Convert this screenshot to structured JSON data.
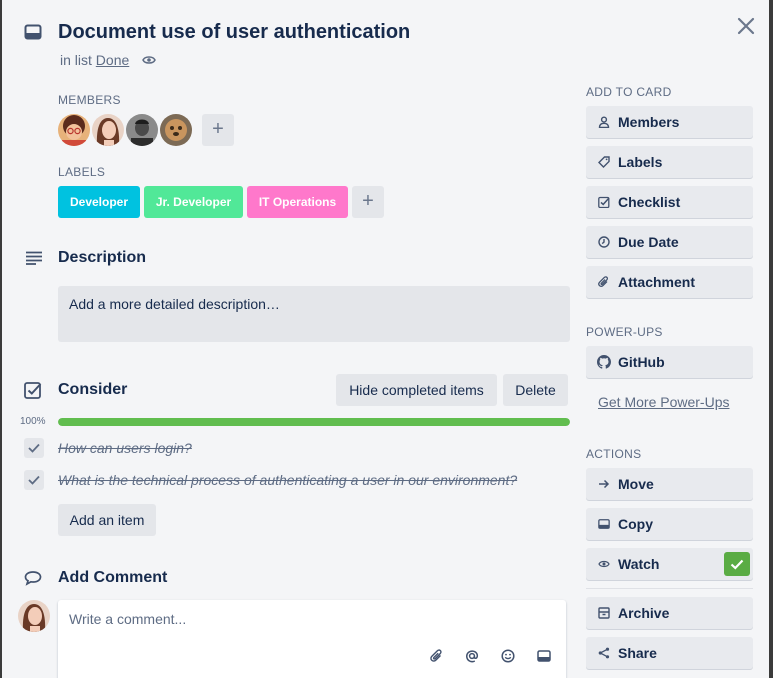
{
  "card": {
    "title": "Document use of user authentication",
    "in_list_prefix": "in list",
    "list_name": "Done"
  },
  "members": {
    "heading": "MEMBERS",
    "add_label": "+"
  },
  "labels": {
    "heading": "LABELS",
    "items": [
      {
        "text": "Developer",
        "color": "#00c2e0"
      },
      {
        "text": "Jr. Developer",
        "color": "#51e898"
      },
      {
        "text": "IT Operations",
        "color": "#ff78cb"
      }
    ],
    "add_label": "+"
  },
  "description": {
    "heading": "Description",
    "placeholder": "Add a more detailed description…"
  },
  "checklist": {
    "heading": "Consider",
    "hide_button": "Hide completed items",
    "delete_button": "Delete",
    "percent_text": "100%",
    "progress": 1.0,
    "progress_color": "#61bd4f",
    "items": [
      {
        "text": "How can users login?"
      },
      {
        "text": "What is the technical process of authenticating a user in our environment?"
      }
    ],
    "add_item_button": "Add an item"
  },
  "comment": {
    "heading": "Add Comment",
    "placeholder": "Write a comment..."
  },
  "sidebar": {
    "add_to_card_heading": "ADD TO CARD",
    "add_to_card": [
      {
        "label": "Members",
        "icon": "person-icon"
      },
      {
        "label": "Labels",
        "icon": "tag-icon"
      },
      {
        "label": "Checklist",
        "icon": "checklist-icon"
      },
      {
        "label": "Due Date",
        "icon": "clock-icon"
      },
      {
        "label": "Attachment",
        "icon": "paperclip-icon"
      }
    ],
    "powerups_heading": "POWER-UPS",
    "github_label": "GitHub",
    "get_more_powerups": "Get More Power-Ups",
    "actions_heading": "ACTIONS",
    "actions": [
      {
        "label": "Move",
        "icon": "arrow-right-icon"
      },
      {
        "label": "Copy",
        "icon": "card-icon"
      },
      {
        "label": "Watch",
        "icon": "eye-icon"
      },
      {
        "label": "Archive",
        "icon": "archive-icon"
      },
      {
        "label": "Share",
        "icon": "share-icon"
      }
    ],
    "watch_active": true,
    "watch_check_color": "#5aac44"
  }
}
